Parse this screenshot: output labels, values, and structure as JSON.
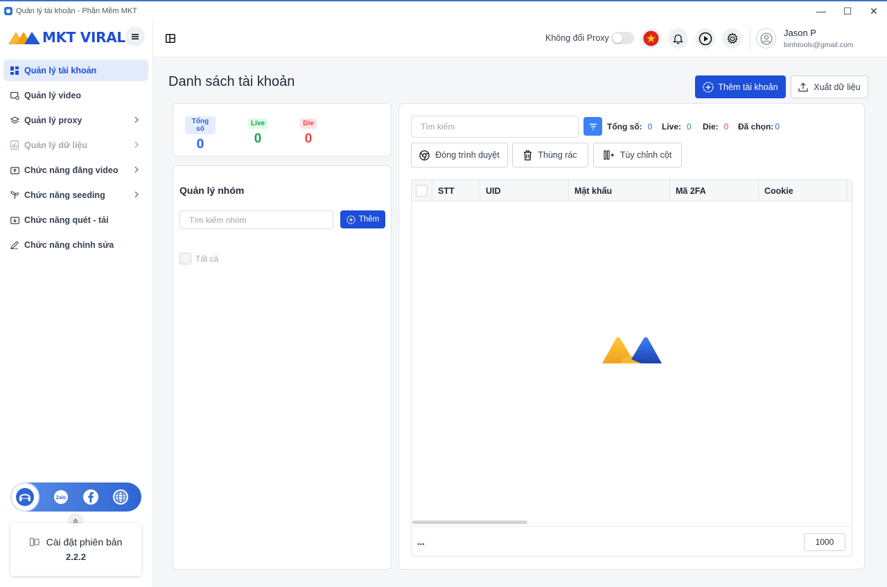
{
  "window": {
    "title": "Quản lý tài khoản - Phần Mềm MKT"
  },
  "brand": {
    "name": "MKT VIRAL"
  },
  "sidebar": {
    "items": [
      {
        "label": "Quản lý tài khoản",
        "icon": "dashboard-icon",
        "active": true
      },
      {
        "label": "Quản lý video",
        "icon": "video-settings-icon"
      },
      {
        "label": "Quản lý proxy",
        "icon": "layers-icon",
        "chevron": true
      },
      {
        "label": "Quản lý dữ liệu",
        "icon": "data-chart-icon",
        "chevron": true,
        "disabled": true
      },
      {
        "label": "Chức năng đăng video",
        "icon": "upload-video-icon",
        "chevron": true
      },
      {
        "label": "Chức năng seeding",
        "icon": "seeding-icon",
        "chevron": true
      },
      {
        "label": "Chức năng quét - tải",
        "icon": "scan-download-icon"
      },
      {
        "label": "Chức năng chỉnh sửa",
        "icon": "edit-pen-icon"
      }
    ],
    "social": [
      "support-headset-icon",
      "zalo-icon",
      "facebook-icon",
      "globe-icon"
    ],
    "version": {
      "label": "Cài đặt phiên bản",
      "number": "2.2.2"
    }
  },
  "header": {
    "proxy_label": "Không đổi Proxy",
    "user": {
      "name": "Jason P",
      "email": "binhtools@gmail.com"
    }
  },
  "main": {
    "title": "Danh sách tài khoản",
    "add_account_label": "Thêm tài khoản",
    "export_label": "Xuất dữ liệu",
    "stats": {
      "total_label": "Tổng số",
      "total_value": "0",
      "live_label": "Live",
      "live_value": "0",
      "die_label": "Die",
      "die_value": "0"
    },
    "groups": {
      "title": "Quản lý nhóm",
      "search_placeholder": "Tìm kiếm nhóm",
      "add_label": "Thêm",
      "all_label": "Tất cả"
    },
    "accounts": {
      "search_placeholder": "Tìm kiếm",
      "summary": {
        "total_label": "Tổng số:",
        "total_value": "0",
        "live_label": "Live:",
        "live_value": "0",
        "die_label": "Die:",
        "die_value": "0",
        "selected_label": "Đã chọn:",
        "selected_value": "0"
      },
      "tools": {
        "close_browser": "Đóng trình duyệt",
        "trash": "Thùng rác",
        "customize_columns": "Tùy chỉnh cột"
      },
      "columns": [
        "STT",
        "UID",
        "Mật khẩu",
        "Mã 2FA",
        "Cookie"
      ],
      "footer": {
        "more": "...",
        "page_size": "1000"
      }
    }
  },
  "colors": {
    "primary": "#1d4ed8",
    "live": "#16a34a",
    "die": "#ef4444",
    "total": "#2563eb"
  }
}
